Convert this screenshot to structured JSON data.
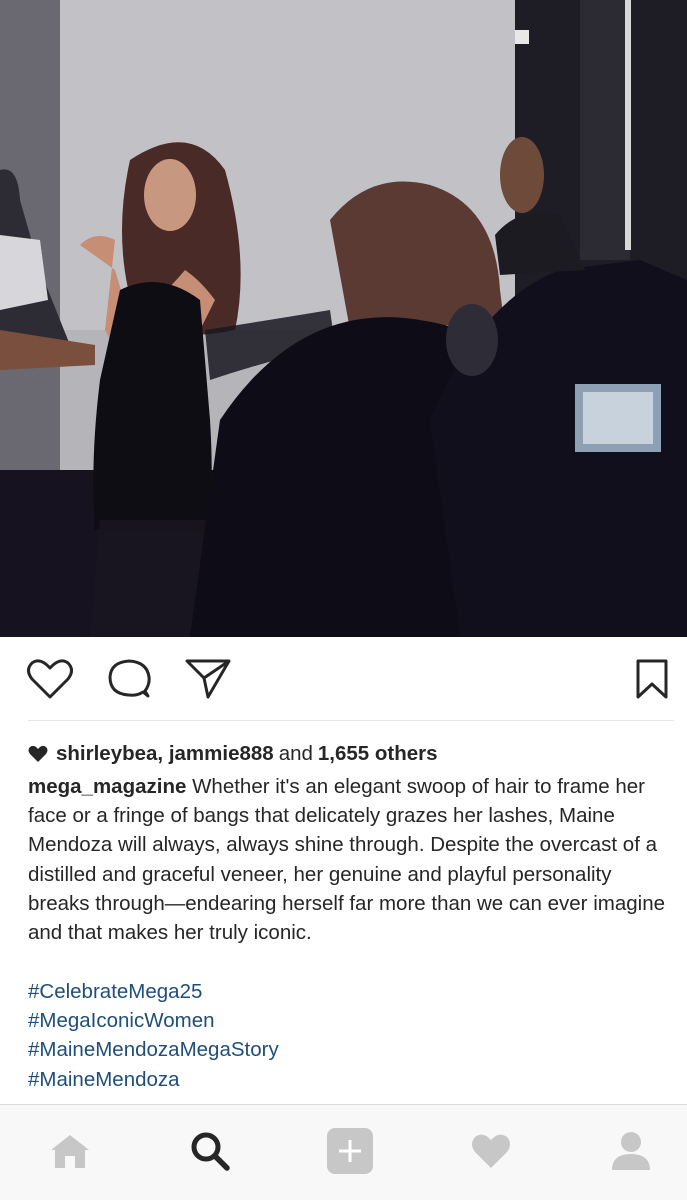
{
  "post": {
    "photo_label": "Photo shoot image",
    "liked_by": {
      "user1": "shirleybea",
      "separator": ",",
      "user2": "jammie888",
      "and_text": "and",
      "others": "1,655 others"
    },
    "caption": {
      "username": "mega_magazine",
      "text": "Whether it's an elegant swoop of hair to frame her face or a fringe of bangs that delicately grazes her lashes, Maine Mendoza will always, always shine through. Despite the overcast of a distilled and graceful veneer, her genuine and playful personality breaks through—endearing herself far more than we can ever imagine and that makes her truly iconic."
    },
    "hashtags": [
      "#CelebrateMega25",
      "#MegaIconicWomen",
      "#MaineMendozaMegaStory",
      "#MaineMendoza"
    ]
  },
  "actions": {
    "like": "heart-outline-icon",
    "comment": "comment-bubble-icon",
    "share": "paper-plane-icon",
    "save": "bookmark-icon"
  },
  "nav": {
    "items": [
      "home-icon",
      "search-icon",
      "add-post-icon",
      "activity-heart-icon",
      "profile-icon"
    ],
    "active": "search-icon"
  },
  "colors": {
    "hashtag": "#1e4e79",
    "text": "#262626",
    "nav_icon_inactive": "#c7c7c7",
    "nav_icon_active": "#262626"
  }
}
